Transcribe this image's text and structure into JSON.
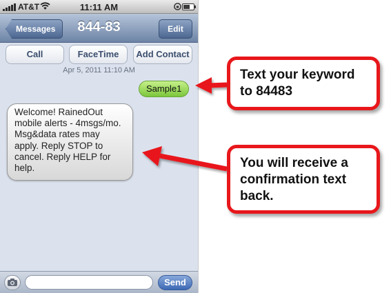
{
  "status_bar": {
    "carrier": "AT&T",
    "time": "11:11 AM"
  },
  "nav": {
    "back_label": "Messages",
    "title": "844-83",
    "edit_label": "Edit"
  },
  "actions": {
    "call": "Call",
    "facetime": "FaceTime",
    "add_contact": "Add Contact"
  },
  "conversation": {
    "timestamp": "Apr 5, 2011 11:10 AM",
    "sent_message": "Sample1",
    "received_lines": [
      "Welcome! RainedOut",
      "mobile alerts - 4msgs/mo.",
      "Msg&data rates may",
      "apply. Reply STOP to",
      "cancel. Reply HELP for",
      "help."
    ]
  },
  "input_bar": {
    "placeholder": "",
    "send_label": "Send"
  },
  "callouts": {
    "keyword": [
      "Text your keyword",
      "to 84483"
    ],
    "confirm": [
      "You will receive a",
      "confirmation text",
      "back."
    ]
  },
  "colors": {
    "accent_red": "#e8171b",
    "sent_bubble": "#8fd24b",
    "nav_blue": "#6d84a6"
  }
}
